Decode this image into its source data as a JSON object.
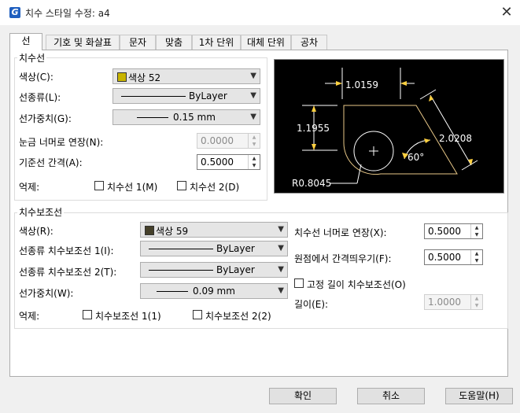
{
  "window": {
    "title": "치수 스타일 수정: a4",
    "app_icon_letter": "G",
    "close_glyph": "✕"
  },
  "tabs": [
    "선",
    "기호 및 화살표",
    "문자",
    "맞춤",
    "1차 단위",
    "대체 단위",
    "공차"
  ],
  "dimension_line": {
    "group_title": "치수선",
    "color_label": "색상(C):",
    "color_value": "색상 52",
    "color_hex": "#c8b400",
    "linetype_label": "선종류(L):",
    "linetype_value": "ByLayer",
    "lineweight_label": "선가중치(G):",
    "lineweight_value": "0.15 mm",
    "extend_label": "눈금 너머로 연장(N):",
    "extend_value": "0.0000",
    "baseline_label": "기준선 간격(A):",
    "baseline_value": "0.5000",
    "suppress_label": "억제:",
    "suppress_1": "치수선 1(M)",
    "suppress_2": "치수선 2(D)"
  },
  "extension_line": {
    "group_title": "치수보조선",
    "color_label": "색상(R):",
    "color_value": "색상 59",
    "color_hex": "#45402a",
    "linetype1_label": "선종류 치수보조선 1(I):",
    "linetype1_value": "ByLayer",
    "linetype2_label": "선종류 치수보조선 2(T):",
    "linetype2_value": "ByLayer",
    "lineweight_label": "선가중치(W):",
    "lineweight_value": "0.09 mm",
    "suppress_label": "억제:",
    "suppress_1": "치수보조선 1(1)",
    "suppress_2": "치수보조선 2(2)",
    "beyond_label": "치수선 너머로 연장(X):",
    "beyond_value": "0.5000",
    "offset_label": "원점에서 간격띄우기(F):",
    "offset_value": "0.5000",
    "fixed_label": "고정 길이 치수보조선(O)",
    "length_label": "길이(E):",
    "length_value": "1.0000"
  },
  "preview": {
    "dim_top": "1.0159",
    "dim_left": "1.1955",
    "dim_right": "2.0208",
    "angle": "60°",
    "radius": "R0.8045"
  },
  "buttons": {
    "ok": "확인",
    "cancel": "취소",
    "help": "도움말(H)"
  }
}
